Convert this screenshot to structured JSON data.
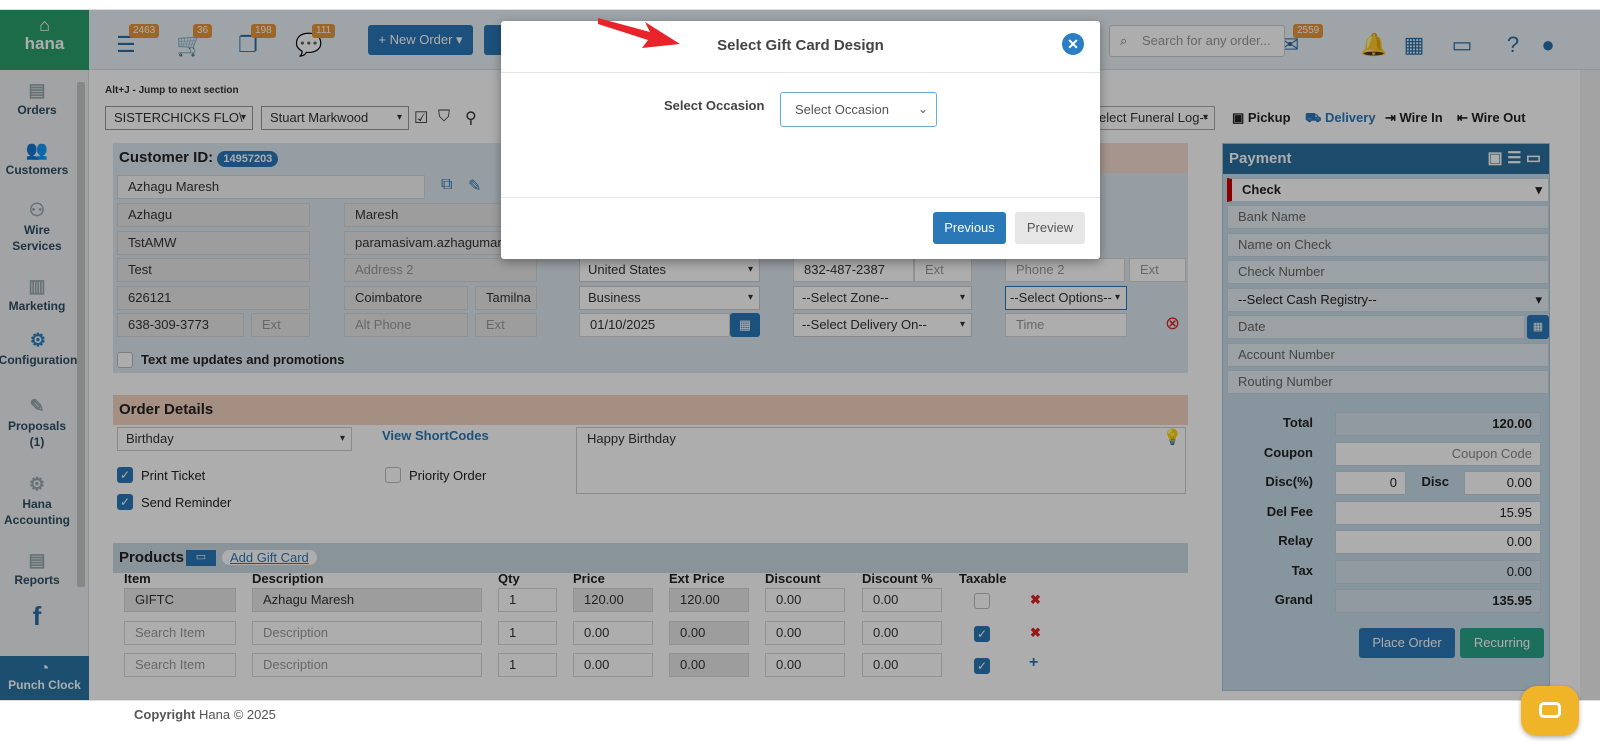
{
  "app": {
    "logo_text": "hana"
  },
  "topbar": {
    "badges": [
      "2463",
      "36",
      "198",
      "111"
    ],
    "new_order_label": "+ New Order ▾",
    "search_placeholder": "Search for any order...",
    "mail_badge": "2559"
  },
  "hint": "Alt+J - Jump to next section",
  "toolbar": {
    "shop": "SISTERCHICKS FLO\\",
    "employee": "Stuart Markwood",
    "funeral_log": "elect Funeral Log--",
    "pickup": "Pickup",
    "delivery": "Delivery",
    "wire_in": "Wire In",
    "wire_out": "Wire Out"
  },
  "sidebar": {
    "items": [
      {
        "label": "Orders"
      },
      {
        "label": "Customers"
      },
      {
        "label": "Wire Services"
      },
      {
        "label": "Marketing"
      },
      {
        "label": "Configuration"
      },
      {
        "label": "Proposals (1)"
      },
      {
        "label": "Hana Accounting"
      },
      {
        "label": "Reports"
      }
    ],
    "punch_clock": "Punch Clock"
  },
  "customer": {
    "id_label": "Customer ID:",
    "id": "14957203",
    "full_name": "Azhagu Maresh",
    "first_name": "Azhagu",
    "last_name": "Maresh",
    "company": "TstAMW",
    "email": "paramasivam.azhagumare",
    "address1": "Test",
    "address2_placeholder": "Address 2",
    "zip": "626121",
    "city": "Coimbatore",
    "state": "Tamilna",
    "phone": "638-309-3773",
    "ext_placeholder": "Ext",
    "alt_phone_placeholder": "Alt Phone",
    "text_me_label": "Text me updates and promotions"
  },
  "recipient": {
    "country": "United States",
    "location_type": "Business",
    "date": "01/10/2025",
    "phone": "832-487-2387",
    "ext_placeholder": "Ext",
    "zone": "--Select Zone--",
    "delivery_on": "--Select Delivery On--",
    "phone2_placeholder": "Phone 2",
    "ext2_placeholder": "Ext",
    "options": "--Select Options--",
    "time_placeholder": "Time"
  },
  "order_details": {
    "title": "Order Details",
    "occasion": "Birthday",
    "view_shortcodes": "View ShortCodes",
    "card_message": "Happy Birthday",
    "print_ticket": "Print Ticket",
    "send_reminder": "Send Reminder",
    "priority_order": "Priority Order"
  },
  "products": {
    "title": "Products",
    "add_gift_card": "Add Gift Card",
    "headers": [
      "Item",
      "Description",
      "Qty",
      "Price",
      "Ext Price",
      "Discount",
      "Discount %",
      "Taxable"
    ],
    "rows": [
      {
        "item": "GIFTC",
        "description": "Azhagu Maresh",
        "qty": "1",
        "price": "120.00",
        "ext": "120.00",
        "discount": "0.00",
        "discount_pct": "0.00"
      },
      {
        "item": "Search Item",
        "description": "Description",
        "qty": "1",
        "price": "0.00",
        "ext": "0.00",
        "discount": "0.00",
        "discount_pct": "0.00"
      },
      {
        "item": "Search Item",
        "description": "Description",
        "qty": "1",
        "price": "0.00",
        "ext": "0.00",
        "discount": "0.00",
        "discount_pct": "0.00"
      }
    ]
  },
  "payment": {
    "title": "Payment",
    "method": "Check",
    "fields": [
      "Bank Name",
      "Name on Check",
      "Check Number"
    ],
    "cash_registry": "--Select Cash Registry--",
    "date_placeholder": "Date",
    "account_placeholder": "Account Number",
    "routing_placeholder": "Routing Number",
    "totals": {
      "total_label": "Total",
      "total": "120.00",
      "coupon_label": "Coupon",
      "coupon_placeholder": "Coupon Code",
      "disc_pct_label": "Disc(%)",
      "disc_pct": "0",
      "disc_label": "Disc",
      "disc": "0.00",
      "del_fee_label": "Del Fee",
      "del_fee": "15.95",
      "relay_label": "Relay",
      "relay": "0.00",
      "tax_label": "Tax",
      "tax": "0.00",
      "grand_label": "Grand",
      "grand": "135.95"
    },
    "place_order": "Place Order",
    "recurring": "Recurring"
  },
  "footer": {
    "copyright_bold": "Copyright",
    "copyright_rest": " Hana © 2025"
  },
  "modal": {
    "title": "Select Gift Card Design",
    "occasion_label": "Select Occasion",
    "occasion_select": "Select Occasion",
    "previous": "Previous",
    "preview": "Preview"
  },
  "colors": {
    "brand_green": "#2aa06e",
    "accent_blue": "#2a78b8",
    "badge_orange": "#e8973a",
    "arrow_red": "#e8232a"
  }
}
